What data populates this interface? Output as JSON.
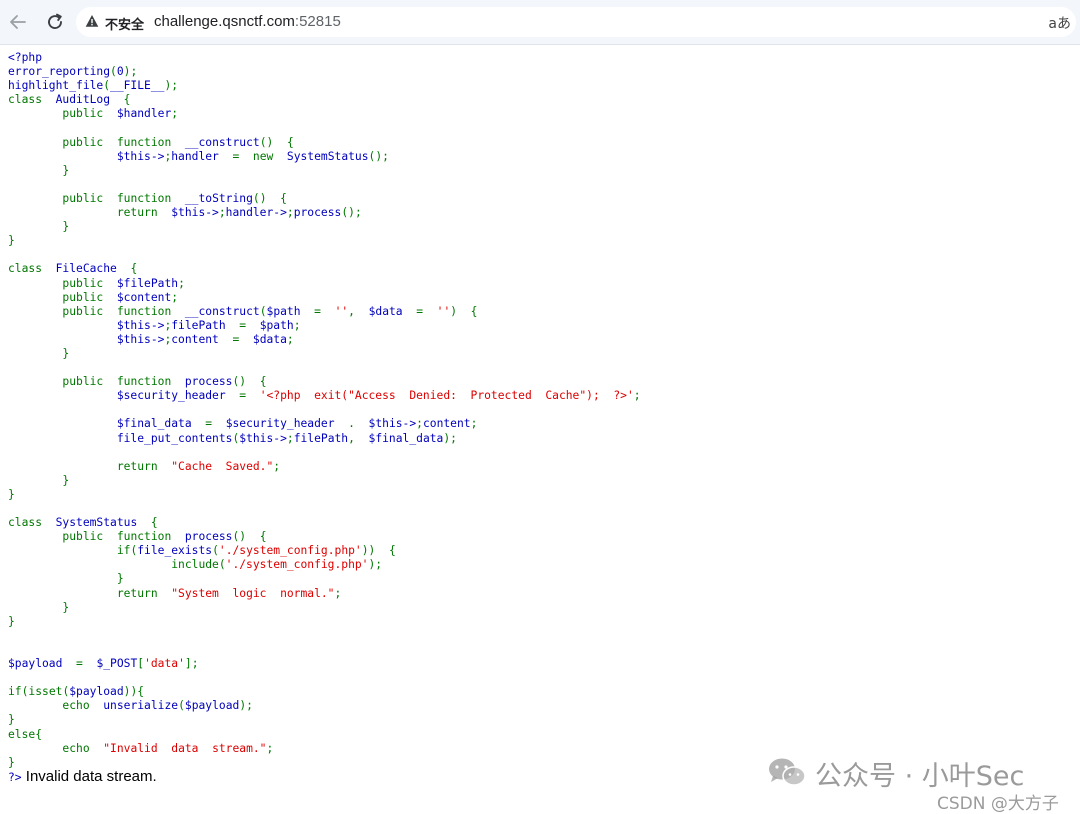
{
  "browser": {
    "security_label": "不安全",
    "url_host": "challenge.qsnctf.com",
    "url_port": ":52815",
    "translate_glyph": "aあ",
    "icons": [
      "back-arrow-icon",
      "reload-icon",
      "warning-icon",
      "translate-icon"
    ]
  },
  "code_lines": [
    "<?php",
    "error_reporting(0);",
    "highlight_file(__FILE__);",
    "class  AuditLog  {",
    "        public  $handler;",
    "",
    "        public  function  __construct()  {",
    "                $this->handler  =  new  SystemStatus();",
    "        }",
    "",
    "        public  function  __toString()  {",
    "                return  $this->handler->process();",
    "        }",
    "}",
    "",
    "class  FileCache  {",
    "        public  $filePath;",
    "        public  $content;",
    "        public  function  __construct($path  =  '',  $data  =  '')  {",
    "                $this->filePath  =  $path;",
    "                $this->content  =  $data;",
    "        }",
    "",
    "        public  function  process()  {",
    "                $security_header  =  '<?php  exit(\"Access  Denied:  Protected  Cache\");  ?>';",
    "",
    "                $final_data  =  $security_header  .  $this->content;",
    "                file_put_contents($this->filePath,  $final_data);",
    "",
    "                return  \"Cache  Saved.\";",
    "        }",
    "}",
    "",
    "class  SystemStatus  {",
    "        public  function  process()  {",
    "                if(file_exists('./system_config.php'))  {",
    "                        include('./system_config.php');",
    "                }",
    "                return  \"System  logic  normal.\";",
    "        }",
    "}",
    "",
    "",
    "$payload  =  $_POST['data'];",
    "",
    "if(isset($payload)){",
    "        echo  unserialize($payload);",
    "}",
    "else{",
    "        echo  \"Invalid  data  stream.\";",
    "}",
    "?>"
  ],
  "output_text": " Invalid data stream.",
  "watermark": {
    "title": "公众号 · 小叶Sec",
    "sub": "CSDN @大方子",
    "icon": "wechat-logo-icon"
  },
  "colors": {
    "keyword": "#007700",
    "default": "#0000bb",
    "string": "#dd0000"
  }
}
